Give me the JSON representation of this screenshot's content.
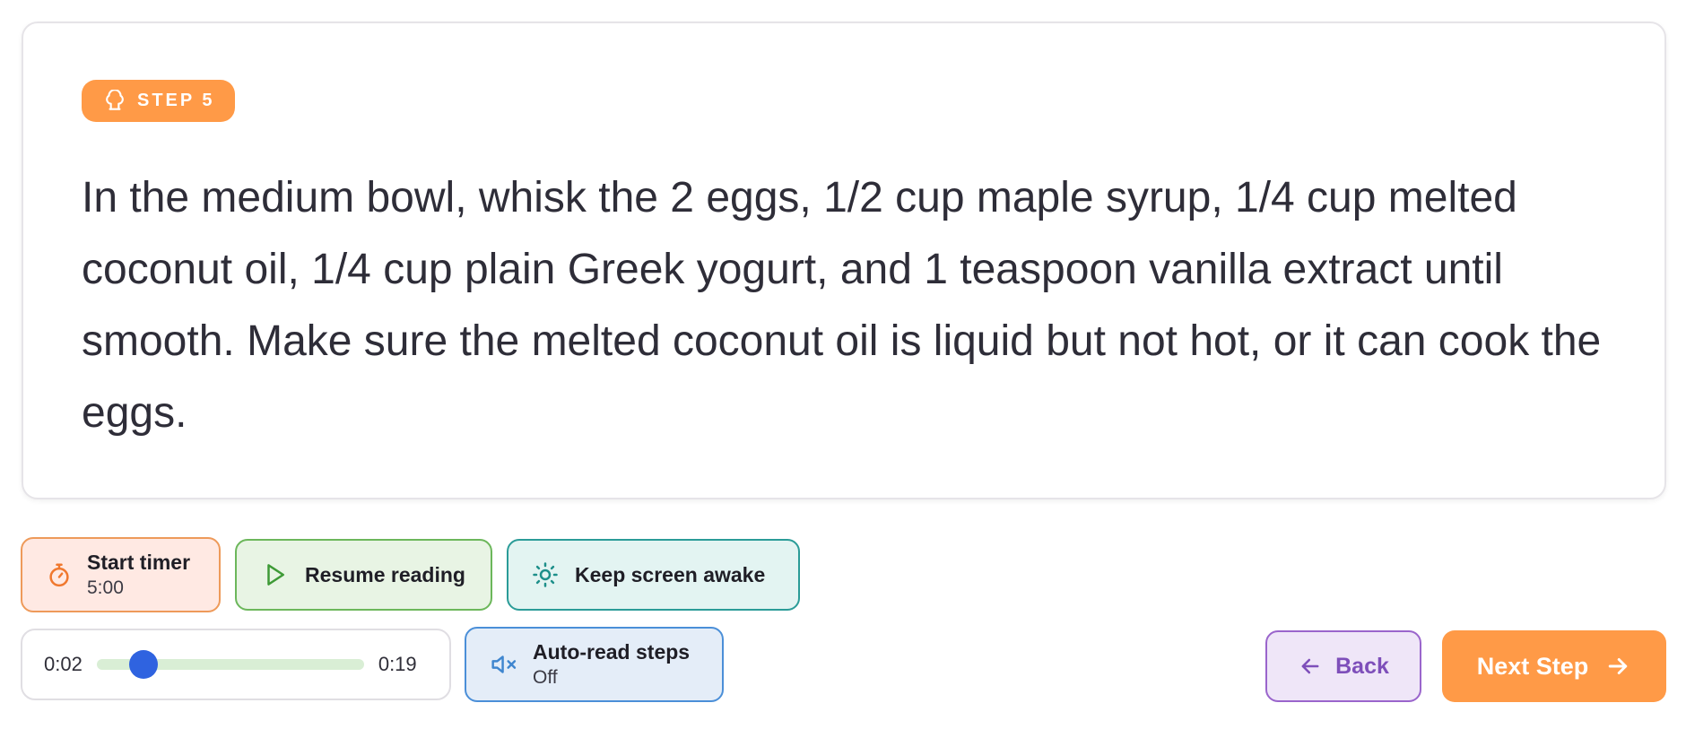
{
  "step": {
    "badge_label": "STEP 5",
    "instruction": "In the medium bowl, whisk the 2 eggs, 1/2 cup maple syrup, 1/4 cup melted coconut oil, 1/4 cup plain Greek yogurt, and 1 teaspoon vanilla extract until smooth. Make sure the melted coconut oil is liquid but not hot, or it can cook the eggs."
  },
  "controls": {
    "timer": {
      "label": "Start timer",
      "value": "5:00",
      "icon": "stopwatch-icon"
    },
    "resume": {
      "label": "Resume reading",
      "icon": "play-icon"
    },
    "awake": {
      "label": "Keep screen awake",
      "icon": "sun-icon"
    },
    "player": {
      "elapsed": "0:02",
      "duration": "0:19",
      "progress_fraction": 0.105
    },
    "autoread": {
      "label": "Auto-read steps",
      "state": "Off",
      "icon": "speaker-muted-icon"
    }
  },
  "nav": {
    "back_label": "Back",
    "next_label": "Next Step"
  },
  "colors": {
    "accent": "#ff9a47",
    "timer_bg": "#ffe9e3",
    "resume_bg": "#e8f4e4",
    "awake_bg": "#e3f4f2",
    "autoread_bg": "#e4edf8",
    "back_bg": "#efe6f8",
    "slider_thumb": "#2f63e0"
  }
}
